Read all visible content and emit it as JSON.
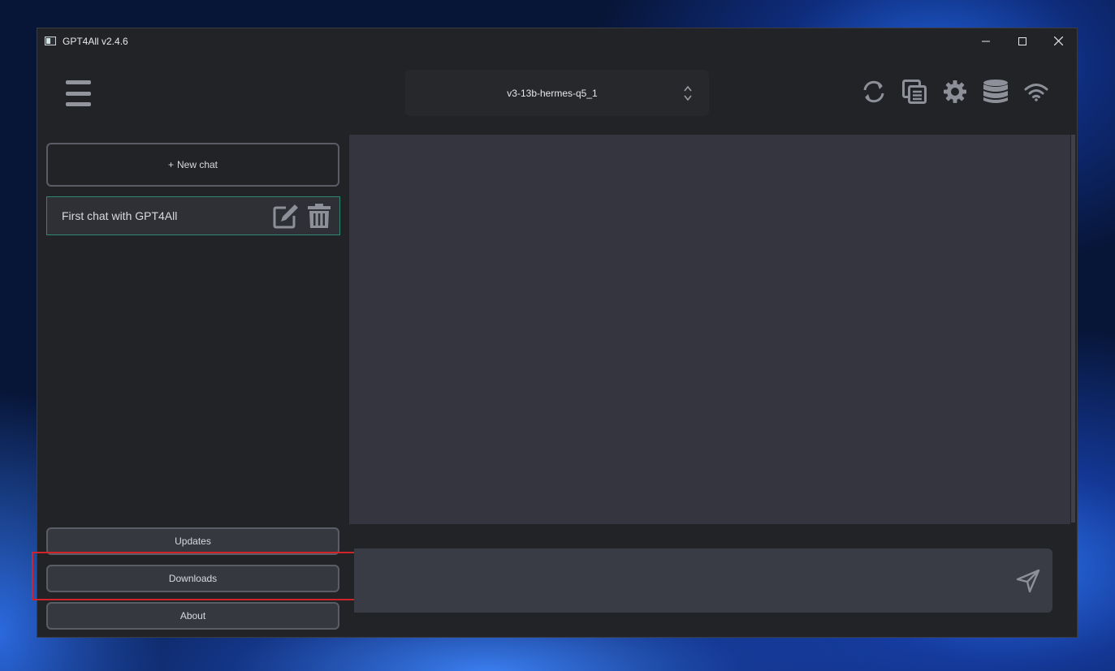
{
  "window": {
    "title": "GPT4All v2.4.6",
    "controls": [
      "minimize",
      "maximize",
      "close"
    ]
  },
  "header": {
    "model": "v3-13b-hermes-q5_1",
    "icons": [
      "reset-icon",
      "copy-icon",
      "settings-icon",
      "database-icon",
      "network-icon"
    ]
  },
  "sidebar": {
    "new_chat_label": "New chat",
    "new_chat_prefix": "+",
    "chats": [
      {
        "title": "First chat with GPT4All"
      }
    ],
    "buttons": {
      "updates": "Updates",
      "downloads": "Downloads",
      "about": "About"
    }
  },
  "chat": {
    "input_value": "",
    "input_placeholder": ""
  },
  "colors": {
    "background": "#222327",
    "chat_area": "#34353e",
    "selected_border": "#2e8a72",
    "highlight": "#d0232a"
  }
}
